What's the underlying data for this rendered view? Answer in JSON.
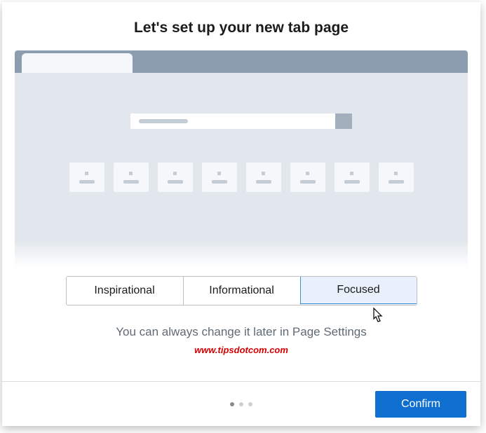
{
  "title": "Let's set up your new tab page",
  "options": {
    "inspirational": "Inspirational",
    "informational": "Informational",
    "focused": "Focused",
    "selected": "focused"
  },
  "hint": "You can always change it later in Page Settings",
  "watermark": "www.tipsdotcom.com",
  "footer": {
    "confirm_label": "Confirm",
    "step_count": 3,
    "active_step": 1
  }
}
